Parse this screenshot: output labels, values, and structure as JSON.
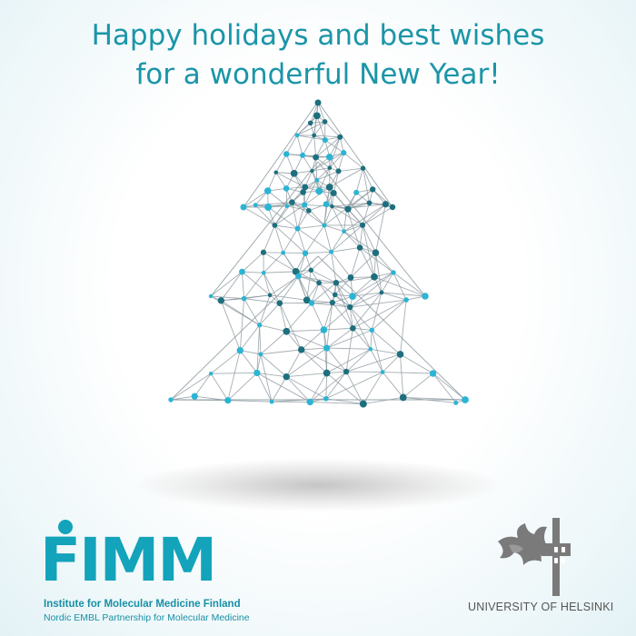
{
  "greeting": {
    "line1": "Happy holidays and best wishes",
    "line2": "for a wonderful New Year!"
  },
  "colors": {
    "accent": "#1b95a8",
    "node_light": "#2bb4d4",
    "node_dark": "#1d6f7e",
    "line": "#8d9aa0",
    "fimm_blue": "#13a3bb",
    "uh_gray": "#555555"
  },
  "fimm": {
    "wordmark": "FIMM",
    "name": "Institute for Molecular Medicine Finland",
    "tagline": "Nordic EMBL Partnership for Molecular Medicine"
  },
  "helsinki": {
    "name": "UNIVERSITY OF HELSINKI",
    "emblem_icon": "helsinki-flame-cross-emblem"
  }
}
